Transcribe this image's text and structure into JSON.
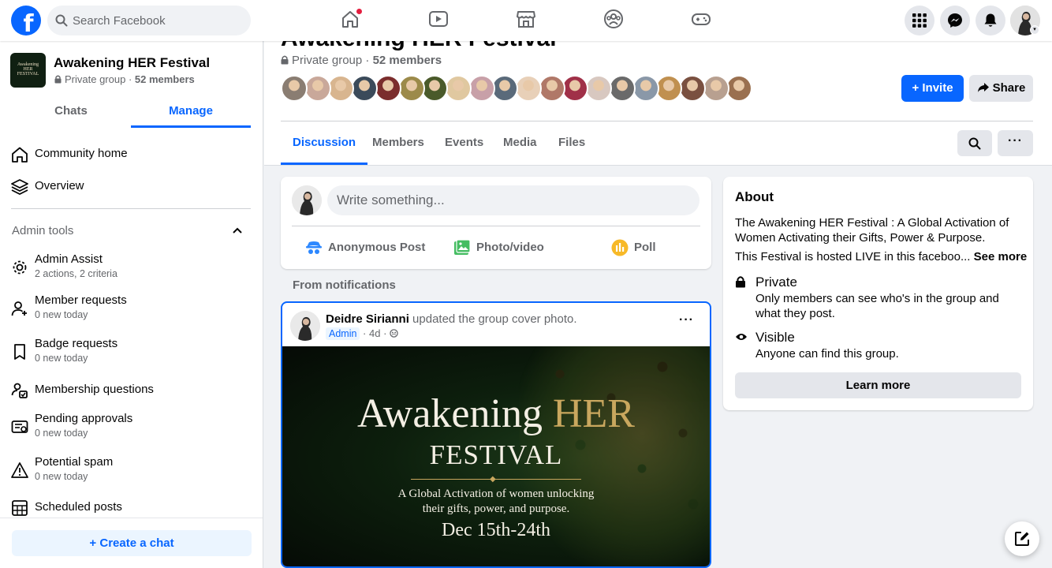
{
  "topbar": {
    "logo": "f",
    "search_placeholder": "Search Facebook",
    "nav_icons": [
      "home-icon",
      "watch-icon",
      "marketplace-icon",
      "groups-icon",
      "gaming-icon"
    ],
    "right_icons": [
      "menu-grid-icon",
      "messenger-icon",
      "notifications-icon"
    ]
  },
  "sidebar": {
    "group_name": "Awakening HER Festival",
    "thumb_text": "Awakening HER FESTIVAL",
    "privacy": "Private group",
    "members": "52 members",
    "tabs": [
      "Chats",
      "Manage"
    ],
    "nav": [
      {
        "label": "Community home",
        "icon": "home-outline-icon"
      },
      {
        "label": "Overview",
        "icon": "layers-icon"
      }
    ],
    "admin_tools_heading": "Admin tools",
    "admin_tools": [
      {
        "label": "Admin Assist",
        "sub": "2 actions, 2 criteria",
        "icon": "gear-icon"
      },
      {
        "label": "Member requests",
        "sub": "0 new today",
        "icon": "person-add-icon"
      },
      {
        "label": "Badge requests",
        "sub": "0 new today",
        "icon": "badge-icon"
      },
      {
        "label": "Membership questions",
        "sub": "",
        "icon": "questions-icon"
      },
      {
        "label": "Pending approvals",
        "sub": "0 new today",
        "icon": "approvals-icon"
      },
      {
        "label": "Potential spam",
        "sub": "0 new today",
        "icon": "warning-icon"
      },
      {
        "label": "Scheduled posts",
        "sub": "",
        "icon": "calendar-icon"
      }
    ],
    "create_chat": "Create a chat"
  },
  "header": {
    "title": "Awakening HER Festival",
    "privacy": "Private group",
    "members": "52 members",
    "invite_label": "Invite",
    "share_label": "Share",
    "tabs": [
      "Discussion",
      "Members",
      "Events",
      "Media",
      "Files"
    ],
    "active_tab": "Discussion",
    "avatar_colors": [
      "#8a7d72",
      "#c9a89a",
      "#d8b58f",
      "#3b4a5a",
      "#7b2d2d",
      "#9c8a4a",
      "#4a5a2a",
      "#e0c8a0",
      "#c8a0a8",
      "#5a6a7a",
      "#e8d0b8",
      "#b07868",
      "#a03048",
      "#d8c8c0",
      "#6a6a6a",
      "#8a98a8",
      "#c09050",
      "#7a5040",
      "#b8a090",
      "#9a7050"
    ]
  },
  "composer": {
    "placeholder": "Write something...",
    "actions": [
      "Anonymous Post",
      "Photo/video",
      "Poll"
    ]
  },
  "feed": {
    "section_label": "From notifications",
    "post": {
      "author": "Deidre Sirianni",
      "action": "updated the group cover photo.",
      "badge": "Admin",
      "time": "4d",
      "poster": {
        "title_a": "Awakening",
        "title_b": "HER",
        "subtitle": "FESTIVAL",
        "tagline_1": "A Global Activation of women unlocking",
        "tagline_2": "their gifts, power, and purpose.",
        "date": "Dec 15th-24th"
      }
    }
  },
  "about": {
    "heading": "About",
    "description": "The Awakening HER Festival : A Global Activation of Women Activating their Gifts, Power & Purpose.",
    "description_2": "This Festival is hosted LIVE in this faceboo...",
    "see_more": "See more",
    "private_title": "Private",
    "private_desc": "Only members can see who's in the group and what they post.",
    "visible_title": "Visible",
    "visible_desc": "Anyone can find this group.",
    "learn_more": "Learn more"
  },
  "colors": {
    "accent": "#0866ff",
    "background": "#f0f2f5"
  }
}
